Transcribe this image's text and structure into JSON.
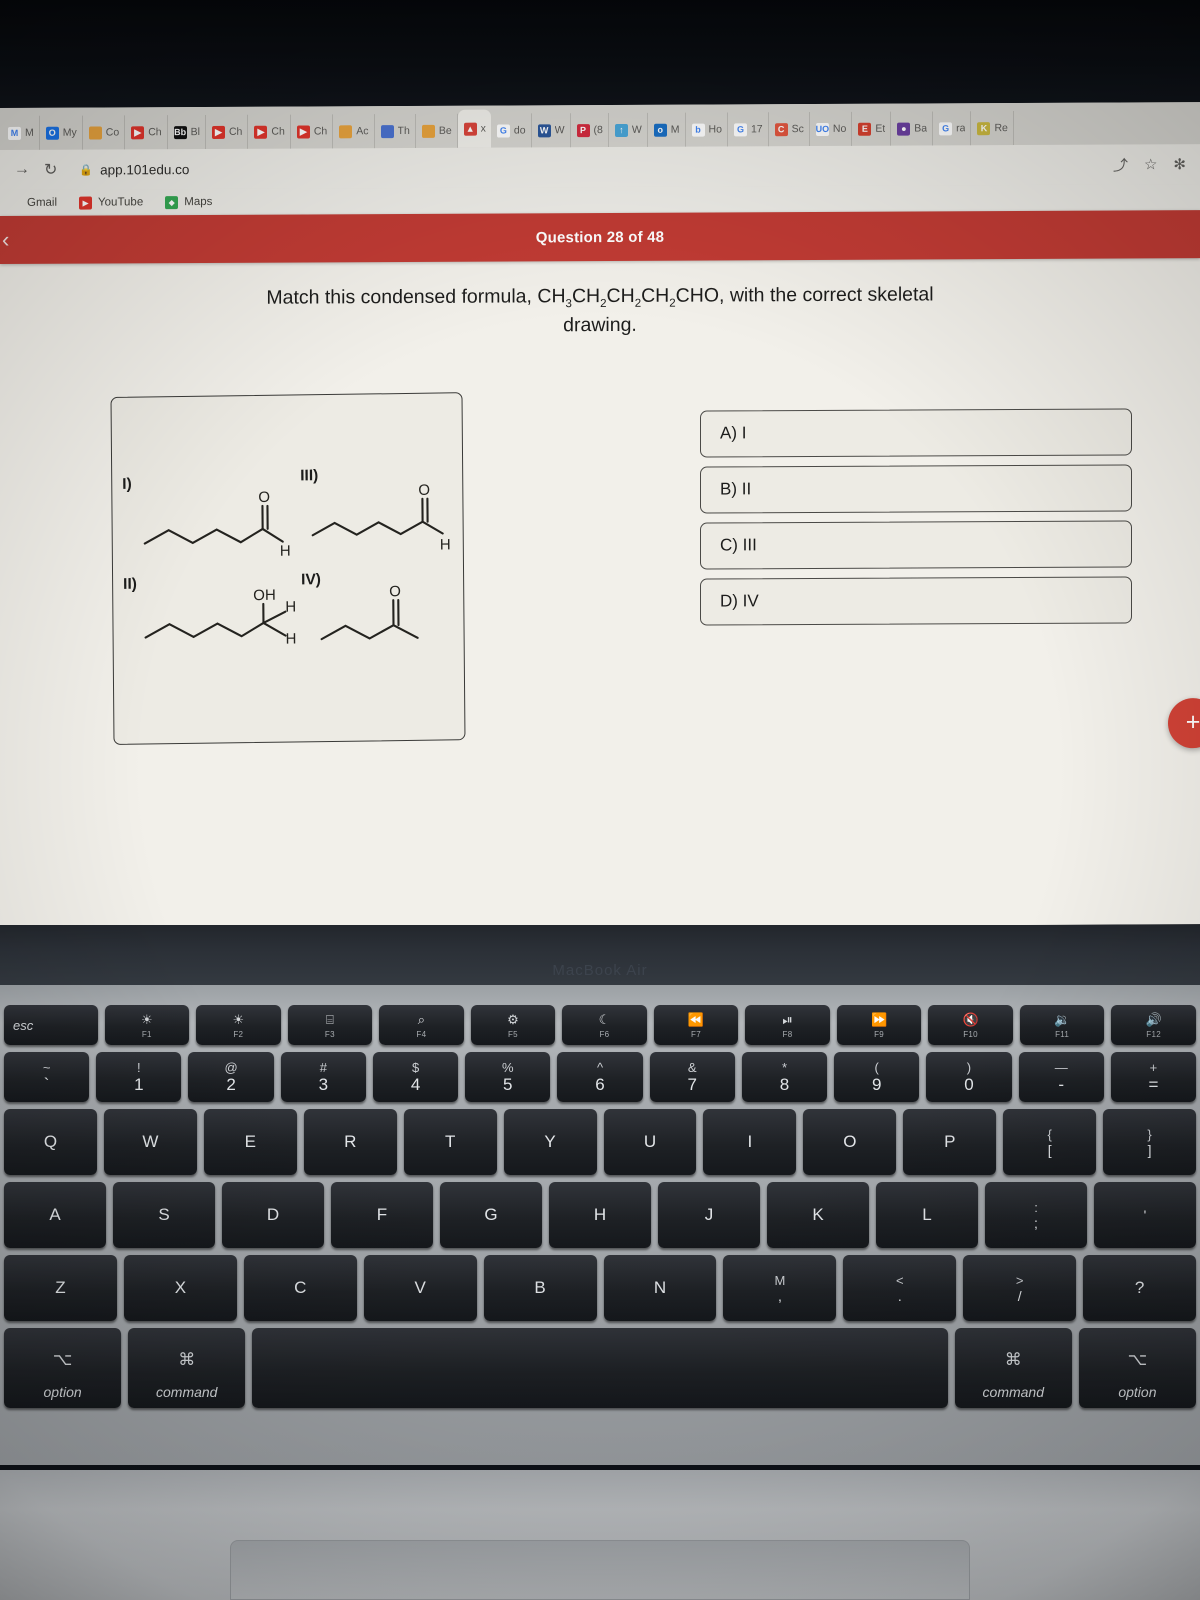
{
  "browser": {
    "tabs": [
      {
        "label": "M",
        "icon": "letter-icon",
        "color": "#ffffff",
        "glyph": "M",
        "active": false
      },
      {
        "label": "My",
        "icon": "circle-icon",
        "color": "#1a73e8",
        "glyph": "O",
        "active": false
      },
      {
        "label": "Co",
        "icon": "doc-icon",
        "color": "#e8a33d",
        "glyph": "",
        "active": false
      },
      {
        "label": "Ch",
        "icon": "youtube-icon",
        "color": "#e0342b",
        "glyph": "▶",
        "active": false
      },
      {
        "label": "Bl",
        "icon": "blackboard-icon",
        "color": "#111111",
        "glyph": "Bb",
        "active": false
      },
      {
        "label": "Ch",
        "icon": "youtube-icon",
        "color": "#e0342b",
        "glyph": "▶",
        "active": false
      },
      {
        "label": "Ch",
        "icon": "youtube-icon",
        "color": "#e0342b",
        "glyph": "▶",
        "active": false
      },
      {
        "label": "Ch",
        "icon": "youtube-icon",
        "color": "#e0342b",
        "glyph": "▶",
        "active": false
      },
      {
        "label": "Ac",
        "icon": "doc-icon",
        "color": "#e8a33d",
        "glyph": "",
        "active": false
      },
      {
        "label": "Th",
        "icon": "square-icon",
        "color": "#4a72d0",
        "glyph": "",
        "active": false
      },
      {
        "label": "Be",
        "icon": "doc-icon",
        "color": "#e8a33d",
        "glyph": "",
        "active": false
      },
      {
        "label": "x",
        "icon": "aktiv-icon",
        "color": "#d9443a",
        "glyph": "▲",
        "active": true
      },
      {
        "label": "do",
        "icon": "google-icon",
        "color": "#ffffff",
        "glyph": "G",
        "active": false
      },
      {
        "label": "W",
        "icon": "word-icon",
        "color": "#2b579a",
        "glyph": "W",
        "active": false
      },
      {
        "label": "(8",
        "icon": "pinterest-icon",
        "color": "#d32b3f",
        "glyph": "P",
        "active": false
      },
      {
        "label": "W",
        "icon": "upload-icon",
        "color": "#49a6d8",
        "glyph": "↑",
        "active": false
      },
      {
        "label": "M",
        "icon": "outlook-icon",
        "color": "#1a6fc4",
        "glyph": "o",
        "active": false
      },
      {
        "label": "Ho",
        "icon": "bing-icon",
        "color": "#ffffff",
        "glyph": "b",
        "active": false
      },
      {
        "label": "17",
        "icon": "google-icon",
        "color": "#ffffff",
        "glyph": "G",
        "active": false
      },
      {
        "label": "Sc",
        "icon": "copy-icon",
        "color": "#e2563f",
        "glyph": "C",
        "active": false
      },
      {
        "label": "No",
        "icon": "uo-icon",
        "color": "#ffffff",
        "glyph": "UO",
        "active": false
      },
      {
        "label": "Et",
        "icon": "e-icon",
        "color": "#d4402e",
        "glyph": "E",
        "active": false
      },
      {
        "label": "Ba",
        "icon": "grape-icon",
        "color": "#6b3fa0",
        "glyph": "●",
        "active": false
      },
      {
        "label": "ra",
        "icon": "google-icon",
        "color": "#ffffff",
        "glyph": "G",
        "active": false
      },
      {
        "label": "Re",
        "icon": "k-icon",
        "color": "#cbb940",
        "glyph": "K",
        "active": false
      }
    ],
    "url": "app.101edu.co",
    "nav": {
      "forward": "→",
      "reload": "↻",
      "lock": "🔒"
    },
    "omni_right": {
      "share": "⤴",
      "star": "☆",
      "profile": "✻"
    },
    "bookmarks": [
      {
        "label": "Gmail",
        "glyph": "",
        "color": "#d93025"
      },
      {
        "label": "YouTube",
        "glyph": "▶",
        "color": "#e0342b"
      },
      {
        "label": "Maps",
        "glyph": "◆",
        "color": "#34a853"
      }
    ]
  },
  "app": {
    "back_icon": "‹",
    "header_title": "Question 28 of 48",
    "question_pre": "Match this condensed formula, ",
    "formula": [
      {
        "text": "CH",
        "sub": "3"
      },
      {
        "text": "CH",
        "sub": "2"
      },
      {
        "text": "CH",
        "sub": "2"
      },
      {
        "text": "CH",
        "sub": "2"
      },
      {
        "text": "CHO",
        "sub": ""
      }
    ],
    "question_post": ", with the correct skeletal drawing.",
    "structures": [
      {
        "id": "I",
        "label": "I)",
        "name": "pentanal",
        "description": "5-carbon straight chain aldehyde with terminal CHO",
        "atoms": [
          "O",
          "H"
        ]
      },
      {
        "id": "II",
        "label": "II)",
        "name": "pentan-1-ol",
        "description": "5-carbon chain ending in carbon bearing OH and two H",
        "atoms": [
          "OH",
          "H",
          "H"
        ]
      },
      {
        "id": "III",
        "label": "III)",
        "name": "hexanal",
        "description": "6-carbon straight chain aldehyde with terminal CHO",
        "atoms": [
          "O",
          "H"
        ]
      },
      {
        "id": "IV",
        "label": "IV)",
        "name": "pentan-2-one",
        "description": "5-carbon chain with internal ketone C=O",
        "atoms": [
          "O"
        ]
      }
    ],
    "answers": [
      {
        "key": "A",
        "label": "A) I"
      },
      {
        "key": "B",
        "label": "B) II"
      },
      {
        "key": "C",
        "label": "C) III"
      },
      {
        "key": "D",
        "label": "D) IV"
      }
    ],
    "fab_label": "+",
    "accent_color": "#c13b34",
    "fab_color": "#d14236"
  },
  "laptop": {
    "model_text": "MacBook Air",
    "fn_row": [
      {
        "label": "esc",
        "sub": ""
      },
      {
        "label": "☀",
        "sub": "F1"
      },
      {
        "label": "☀",
        "sub": "F2"
      },
      {
        "label": "⌸",
        "sub": "F3"
      },
      {
        "label": "⌕",
        "sub": "F4"
      },
      {
        "label": "⚙",
        "sub": "F5"
      },
      {
        "label": "☾",
        "sub": "F6"
      },
      {
        "label": "⏪",
        "sub": "F7"
      },
      {
        "label": "⏯",
        "sub": "F8"
      },
      {
        "label": "⏩",
        "sub": "F9"
      },
      {
        "label": "🔇",
        "sub": "F10"
      },
      {
        "label": "🔉",
        "sub": "F11"
      },
      {
        "label": "🔊",
        "sub": "F12"
      }
    ],
    "num_row": [
      {
        "up": "~",
        "lo": "`"
      },
      {
        "up": "!",
        "lo": "1"
      },
      {
        "up": "@",
        "lo": "2"
      },
      {
        "up": "#",
        "lo": "3"
      },
      {
        "up": "$",
        "lo": "4"
      },
      {
        "up": "%",
        "lo": "5"
      },
      {
        "up": "^",
        "lo": "6"
      },
      {
        "up": "&",
        "lo": "7"
      },
      {
        "up": "*",
        "lo": "8"
      },
      {
        "up": "(",
        "lo": "9"
      },
      {
        "up": ")",
        "lo": "0"
      },
      {
        "up": "—",
        "lo": "-"
      },
      {
        "up": "+",
        "lo": "="
      }
    ],
    "q_row": [
      "Q",
      "W",
      "E",
      "R",
      "T",
      "Y",
      "U",
      "I",
      "O",
      "P",
      "{",
      "}"
    ],
    "q_row_sub": [
      "",
      "",
      "",
      "",
      "",
      "",
      "",
      "",
      "",
      "",
      "[",
      "]"
    ],
    "a_row": [
      "A",
      "S",
      "D",
      "F",
      "G",
      "H",
      "J",
      "K",
      "L",
      ":",
      ""
    ],
    "a_row_sub": [
      "",
      "",
      "",
      "",
      "",
      "",
      "",
      "",
      "",
      ";",
      "'"
    ],
    "z_row": [
      "Z",
      "X",
      "C",
      "V",
      "B",
      "N",
      "M",
      "<",
      ">",
      "?"
    ],
    "z_row_sub": [
      "",
      "",
      "",
      "",
      "",
      "",
      ",",
      ".",
      "/",
      ""
    ],
    "mod_row": [
      {
        "glyph": "⌥",
        "name": "option"
      },
      {
        "glyph": "⌘",
        "name": "command"
      },
      {
        "glyph": "",
        "name": ""
      },
      {
        "glyph": "⌘",
        "name": "command"
      },
      {
        "glyph": "⌥",
        "name": "option"
      }
    ]
  }
}
